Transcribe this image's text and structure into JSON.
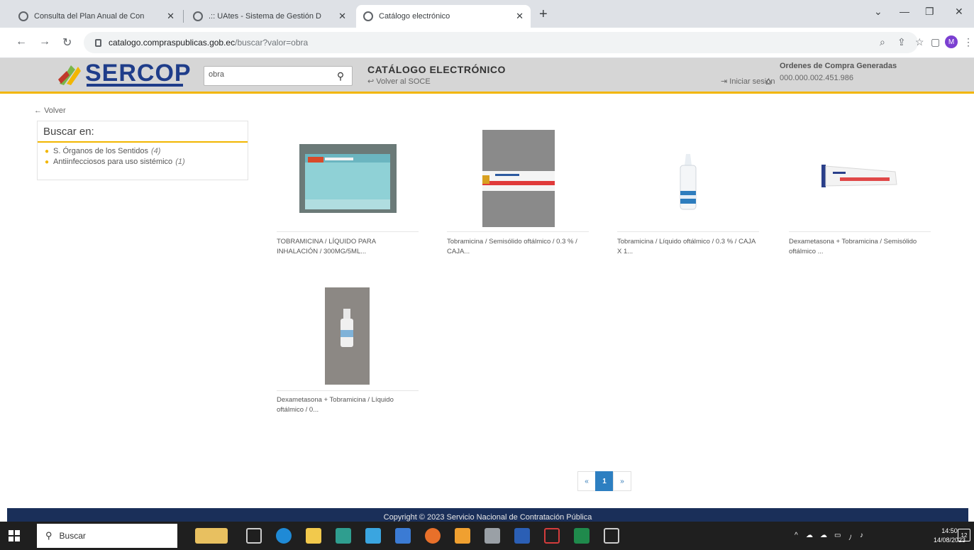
{
  "browser": {
    "tabs": [
      {
        "title": "Consulta del Plan Anual de Con",
        "active": false
      },
      {
        "title": ".:: UAtes - Sistema de Gestión D",
        "active": false
      },
      {
        "title": "Catálogo electrónico",
        "active": true
      }
    ],
    "new_tab": "+",
    "url_host": "catalogo.compraspublicas.gob.ec",
    "url_path": "/buscar?valor=obra",
    "profile_initial": "M"
  },
  "header": {
    "logo_text": "SERCOP",
    "search_value": "obra",
    "catalog_title": "CATÁLOGO ELECTRÓNICO",
    "back_to_soce": "Volver al SOCE",
    "login": "Iniciar sesión",
    "orders_label": "Ordenes de Compra Generadas",
    "orders_value": "000.000.002.451.986",
    "accent_color": "#f2b600",
    "brand_color": "#1f3d8a"
  },
  "content": {
    "back": "Volver",
    "filter_title": "Buscar en:",
    "filters": [
      {
        "label": "S. Órganos de los Sentidos",
        "count": "(4)"
      },
      {
        "label": "Antiinfecciosos para uso sistémico",
        "count": "(1)"
      }
    ],
    "products": [
      {
        "name": "TOBRAMICINA / LÍQUIDO PARA INHALACIÓN / 300MG/5ML..."
      },
      {
        "name": "Tobramicina / Semisólido oftálmico / 0.3 % / CAJA..."
      },
      {
        "name": "Tobramicina / Líquido oftálmico / 0.3 % / CAJA X 1..."
      },
      {
        "name": "Dexametasona + Tobramicina / Semisólido oftálmico ..."
      },
      {
        "name": "Dexametasona + Tobramicina / Líquido oftálmico / 0..."
      }
    ],
    "pager": {
      "prev": "«",
      "current": "1",
      "next": "»"
    }
  },
  "footer": {
    "text": "Copyright © 2023 Servicio Nacional de Contratación Pública"
  },
  "taskbar": {
    "search_placeholder": "Buscar",
    "time": "14:50",
    "date": "14/08/2023",
    "notifications": "12"
  }
}
